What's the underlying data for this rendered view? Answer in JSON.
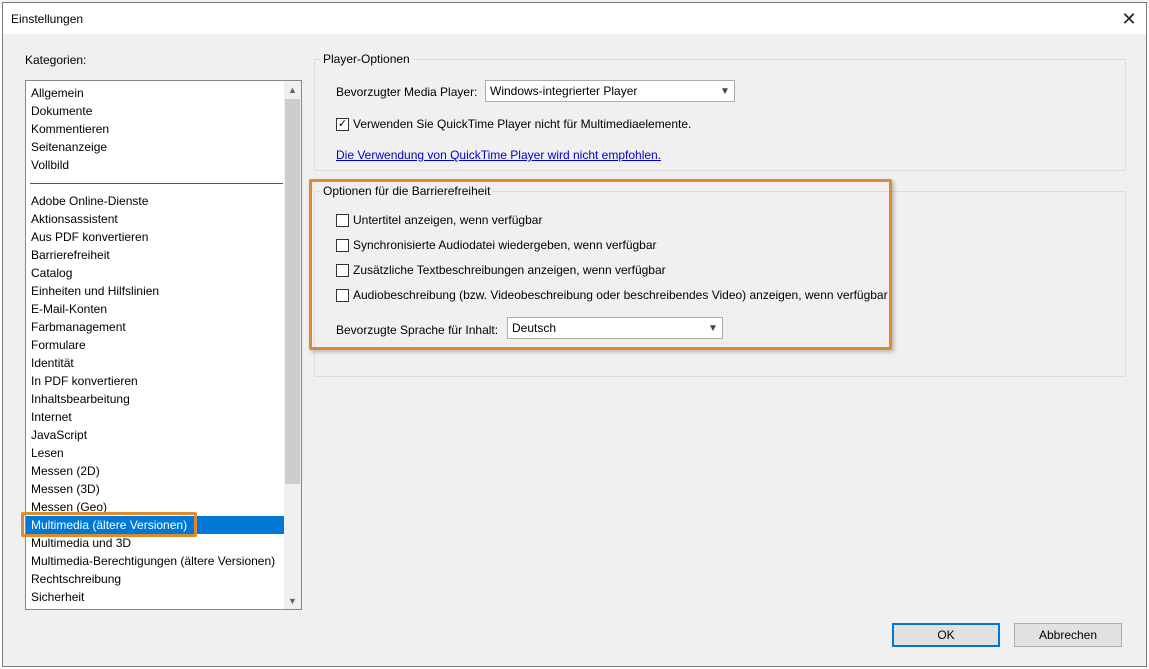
{
  "window": {
    "title": "Einstellungen"
  },
  "categories": {
    "label": "Kategorien:",
    "group1": [
      "Allgemein",
      "Dokumente",
      "Kommentieren",
      "Seitenanzeige",
      "Vollbild"
    ],
    "group2": [
      "Adobe Online-Dienste",
      "Aktionsassistent",
      "Aus PDF konvertieren",
      "Barrierefreiheit",
      "Catalog",
      "Einheiten und Hilfslinien",
      "E-Mail-Konten",
      "Farbmanagement",
      "Formulare",
      "Identität",
      "In PDF konvertieren",
      "Inhaltsbearbeitung",
      "Internet",
      "JavaScript",
      "Lesen",
      "Messen (2D)",
      "Messen (3D)",
      "Messen (Geo)"
    ],
    "selected": "Multimedia (ältere Versionen)",
    "group3": [
      "Multimedia und 3D",
      "Multimedia-Berechtigungen (ältere Versionen)",
      "Rechtschreibung",
      "Sicherheit"
    ]
  },
  "player_options": {
    "title": "Player-Optionen",
    "media_player_label": "Bevorzugter Media Player:",
    "media_player_value": "Windows-integrierter Player",
    "quicktime_label": "Verwenden Sie QuickTime Player nicht für Multimediaelemente.",
    "quicktime_checked": true,
    "link_text": "Die Verwendung von QuickTime Player wird nicht empfohlen."
  },
  "accessibility": {
    "title": "Optionen für die Barrierefreiheit",
    "options": [
      "Untertitel anzeigen, wenn verfügbar",
      "Synchronisierte Audiodatei wiedergeben, wenn verfügbar",
      "Zusätzliche Textbeschreibungen anzeigen, wenn verfügbar",
      "Audiobeschreibung (bzw. Videobeschreibung oder beschreibendes Video) anzeigen, wenn verfügbar"
    ],
    "language_label": "Bevorzugte Sprache für Inhalt:",
    "language_value": "Deutsch"
  },
  "buttons": {
    "ok": "OK",
    "cancel": "Abbrechen"
  },
  "colors": {
    "highlight": "#e08a2e",
    "selection": "#0078d7",
    "link": "#0000cc"
  }
}
